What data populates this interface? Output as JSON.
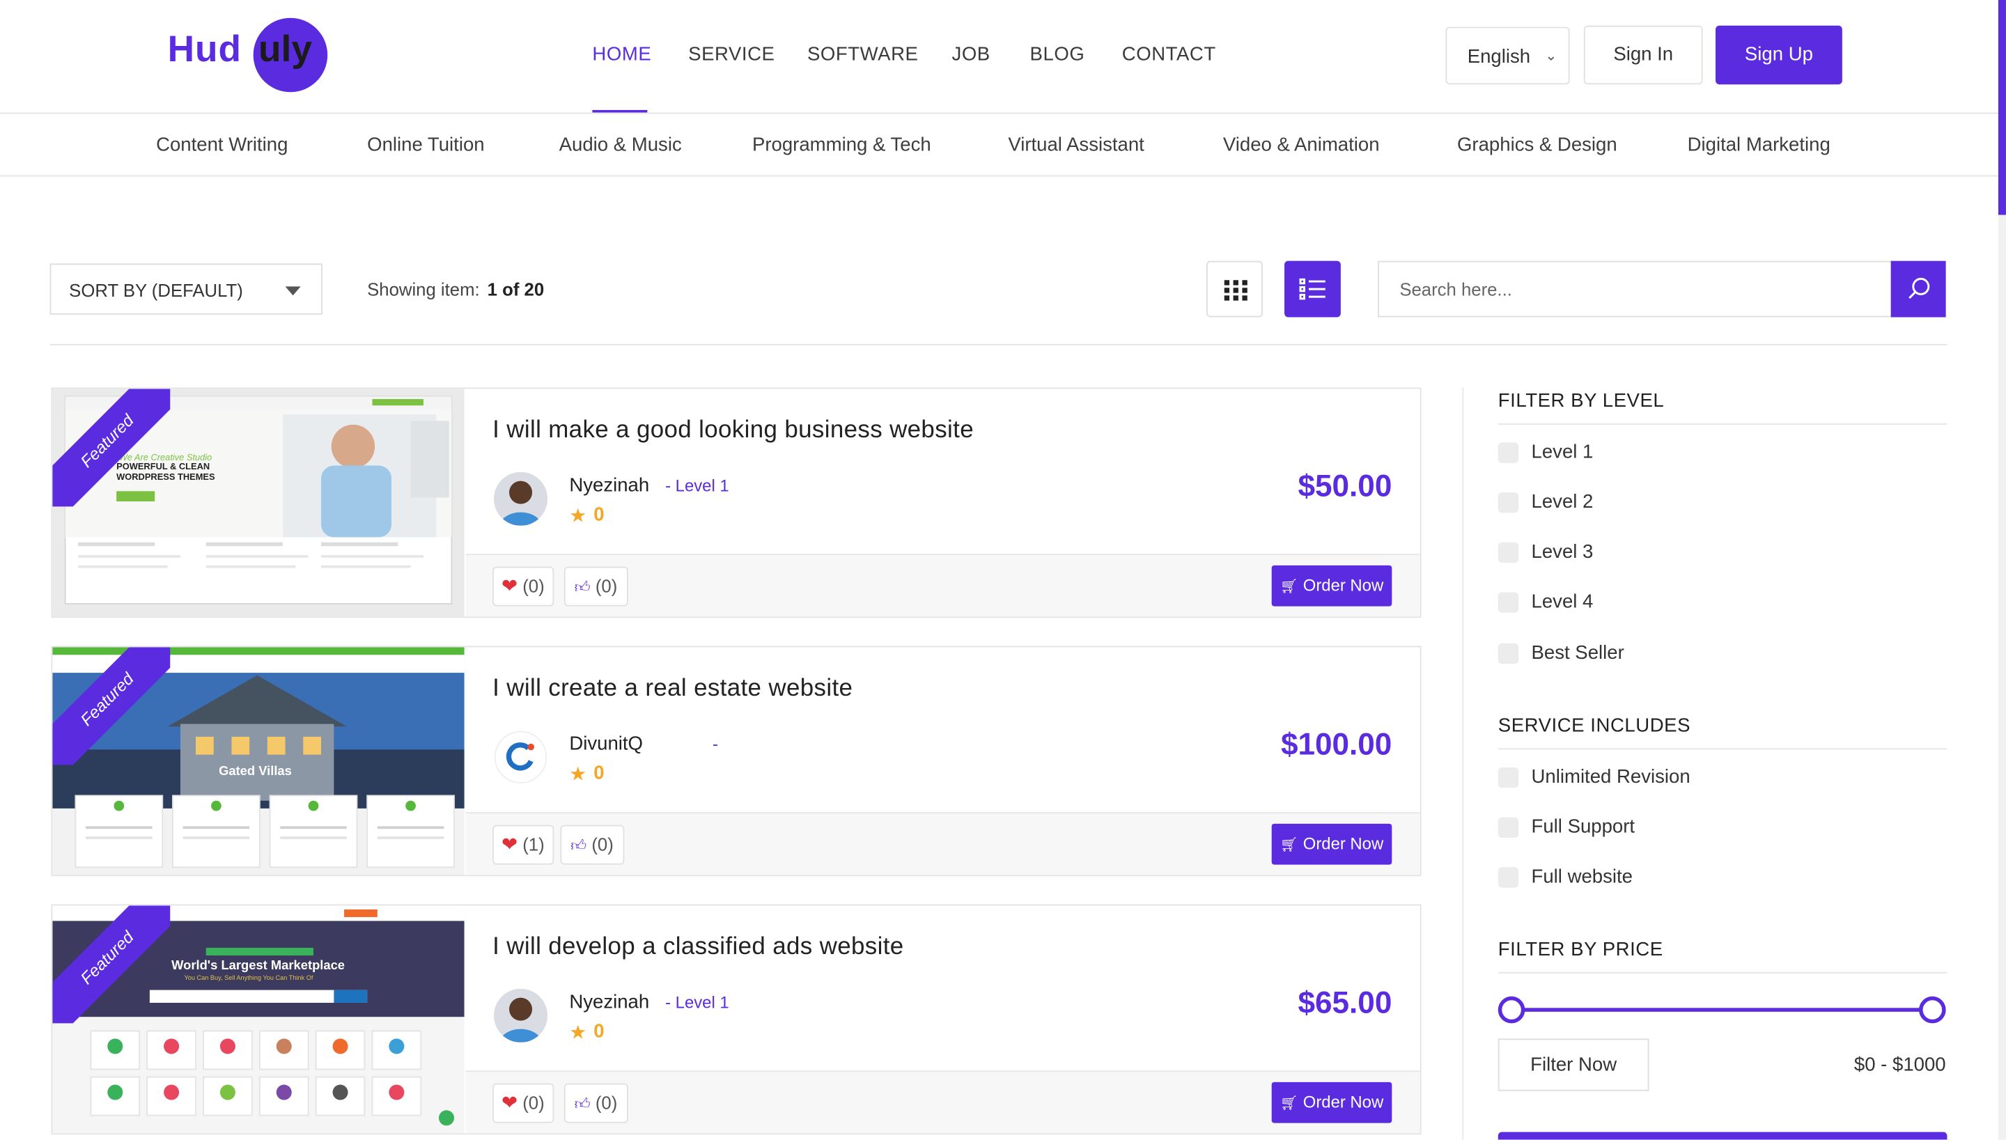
{
  "logo": {
    "part1": "Hud",
    "part2": "uly"
  },
  "nav": [
    {
      "label": "HOME",
      "active": true
    },
    {
      "label": "SERVICE"
    },
    {
      "label": "SOFTWARE"
    },
    {
      "label": "JOB"
    },
    {
      "label": "BLOG"
    },
    {
      "label": "CONTACT"
    }
  ],
  "header": {
    "language": "English",
    "sign_in": "Sign In",
    "sign_up": "Sign Up"
  },
  "categories": [
    "Content Writing",
    "Online Tuition",
    "Audio & Music",
    "Programming & Tech",
    "Virtual Assistant",
    "Video & Animation",
    "Graphics & Design",
    "Digital Marketing"
  ],
  "toolbar": {
    "sort_label": "SORT BY (DEFAULT)",
    "showing_label": "Showing item:",
    "showing_value": "1 of 20",
    "search_placeholder": "Search here..."
  },
  "listings": [
    {
      "badge": "Featured",
      "title": "I will make a good looking business website",
      "seller": "Nyezinah",
      "level": "- Level 1",
      "rating": "0",
      "price": "$50.00",
      "likes": "(0)",
      "thumbs": "(0)",
      "order_label": "Order Now",
      "thumb_texts": {
        "h1": "We Are Creative Studio",
        "h2": "POWERFUL & CLEAN WORDPRESS THEMES"
      }
    },
    {
      "badge": "Featured",
      "title": "I will create a real estate website",
      "seller": "DivunitQ",
      "level": "-",
      "rating": "0",
      "price": "$100.00",
      "likes": "(1)",
      "thumbs": "(0)",
      "order_label": "Order Now",
      "thumb_texts": {
        "h1": "Gated Villas",
        "h2": ""
      }
    },
    {
      "badge": "Featured",
      "title": "I will develop a classified ads website",
      "seller": "Nyezinah",
      "level": "- Level 1",
      "rating": "0",
      "price": "$65.00",
      "likes": "(0)",
      "thumbs": "(0)",
      "order_label": "Order Now",
      "thumb_texts": {
        "h1": "World's Largest Marketplace",
        "h2": "You Can Buy, Sell Anything You Can Think Of"
      }
    }
  ],
  "sidebar": {
    "level_title": "FILTER BY LEVEL",
    "levels": [
      "Level 1",
      "Level 2",
      "Level 3",
      "Level 4",
      "Best Seller"
    ],
    "includes_title": "SERVICE INCLUDES",
    "includes": [
      "Unlimited Revision",
      "Full Support",
      "Full website"
    ],
    "price_title": "FILTER BY PRICE",
    "filter_button": "Filter Now",
    "price_range": "$0 - $1000",
    "price_min": 0,
    "price_max": 1000,
    "slider_low": 0,
    "slider_high": 1
  },
  "colors": {
    "accent": "#5b2be0",
    "star": "#f5a623",
    "heart": "#e0313b"
  }
}
